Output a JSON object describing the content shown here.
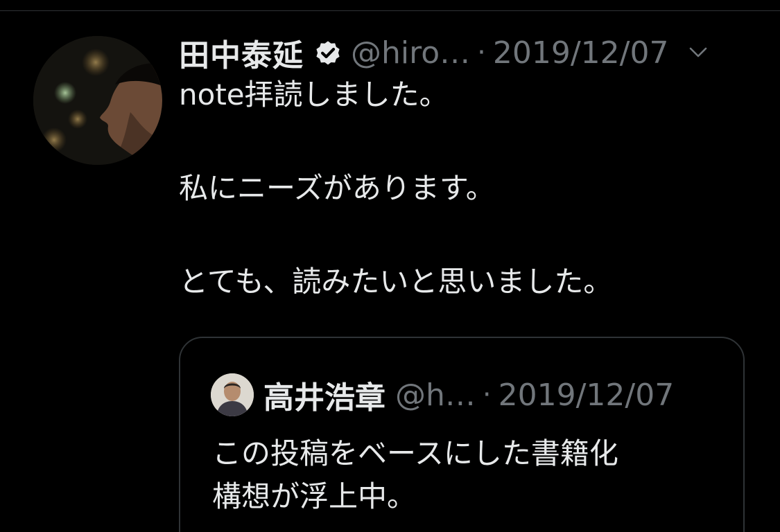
{
  "tweet": {
    "author": {
      "display_name": "田中泰延",
      "handle": "@hiro…",
      "verified": true
    },
    "separator": "·",
    "date": "2019/12/07",
    "menu_icon": "chevron-down-icon",
    "lines": [
      "note拝読しました。",
      "私にニーズがあります。",
      "とても、読みたいと思いました。"
    ]
  },
  "quoted_tweet": {
    "author": {
      "display_name": "高井浩章",
      "handle": "@h…"
    },
    "separator": "·",
    "date": "2019/12/07",
    "lines": [
      "この投稿をベースにした書籍化",
      "構想が浮上中。"
    ]
  },
  "colors": {
    "background": "#000000",
    "text_primary": "#e7e9ea",
    "text_secondary": "#71767b",
    "border": "#2f3336"
  }
}
